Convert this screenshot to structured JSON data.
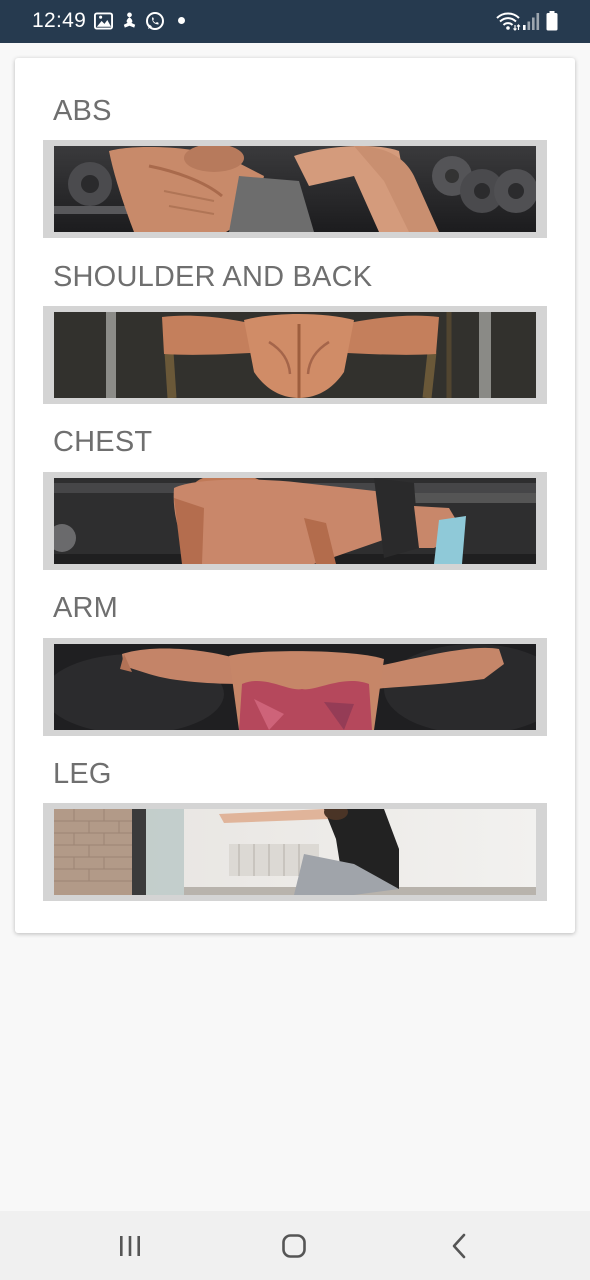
{
  "status_bar": {
    "time": "12:49",
    "left_icons": [
      "gallery-icon",
      "yoga-app-icon",
      "whatsapp-icon",
      "notification-dot-icon"
    ],
    "right_icons": [
      "wifi-icon",
      "signal-icon",
      "battery-icon"
    ]
  },
  "categories": [
    {
      "label": "ABS",
      "image": "abs-workout-photo"
    },
    {
      "label": "SHOULDER AND BACK",
      "image": "back-workout-photo"
    },
    {
      "label": "CHEST",
      "image": "pushup-workout-photo"
    },
    {
      "label": "ARM",
      "image": "arm-flex-photo"
    },
    {
      "label": "LEG",
      "image": "leg-stretch-photo"
    }
  ],
  "nav_bar": {
    "buttons": [
      "recents-icon",
      "home-icon",
      "back-icon"
    ]
  },
  "colors": {
    "status_bar": "#263a4f",
    "title_text": "#6f6f6f",
    "image_frame": "#d4d4d4",
    "background": "#f8f8f8"
  }
}
